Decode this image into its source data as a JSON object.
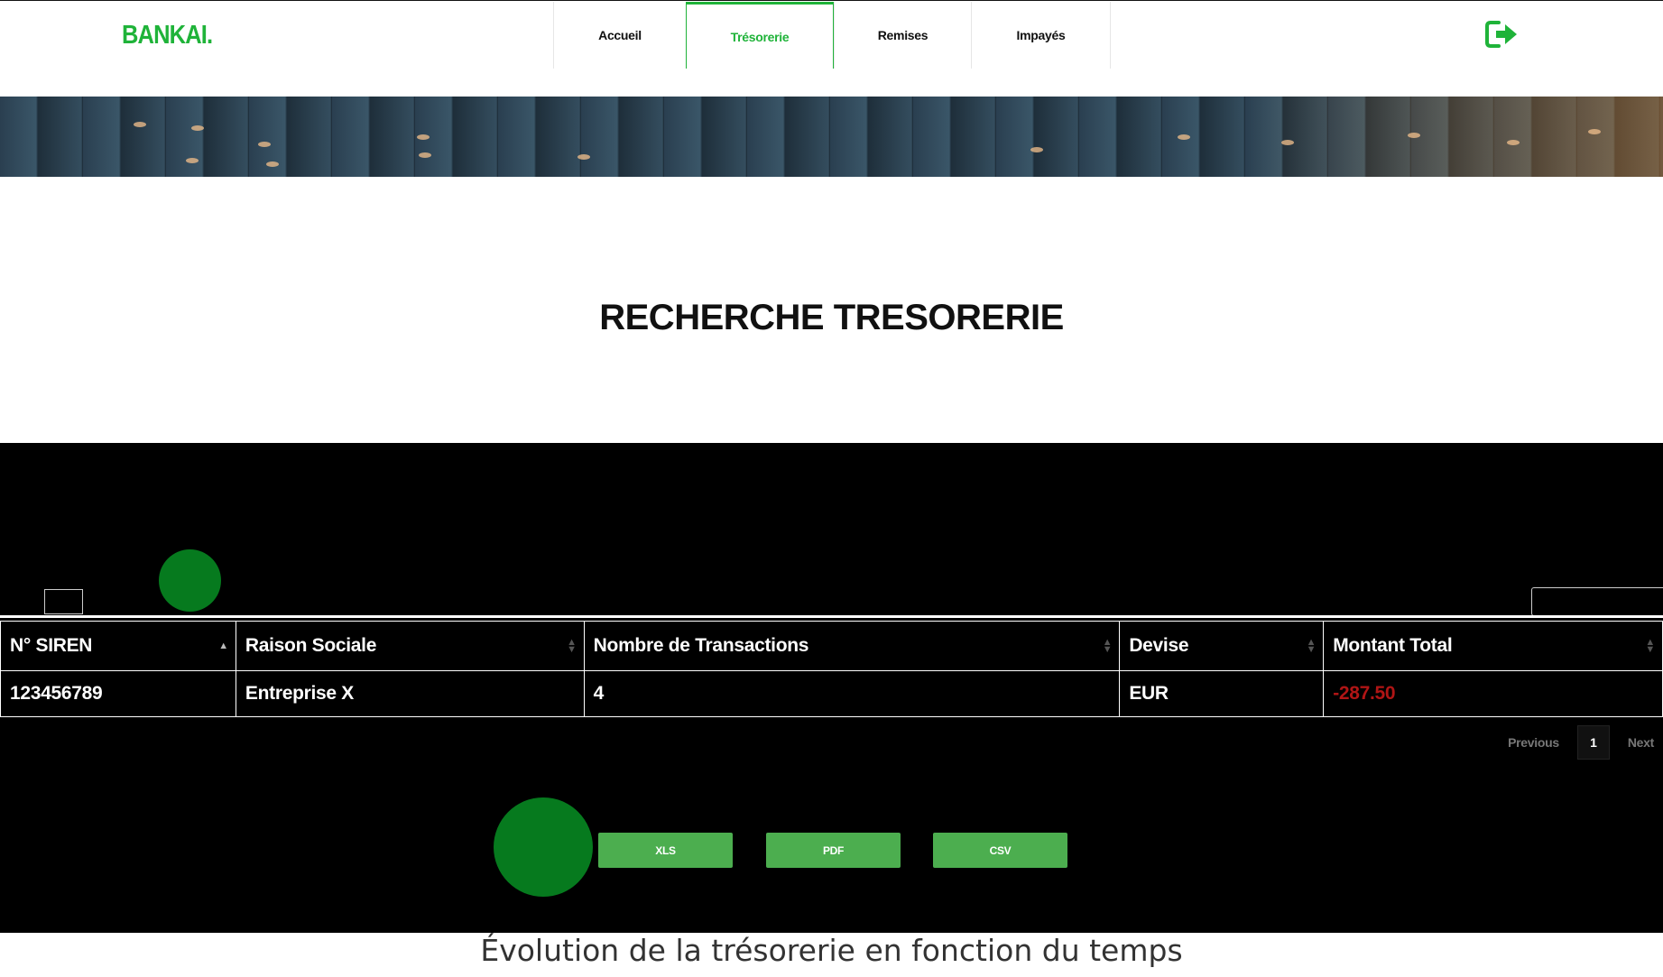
{
  "brand": "BANKAI.",
  "nav": {
    "items": [
      {
        "label": "Accueil",
        "active": false
      },
      {
        "label": "Trésorerie",
        "active": true
      },
      {
        "label": "Remises",
        "active": false
      },
      {
        "label": "Impayés",
        "active": false
      }
    ],
    "logout_icon": "logout-arrow-icon"
  },
  "page_title": "RECHERCHE TRESORERIE",
  "table": {
    "columns": [
      "N° SIREN",
      "Raison Sociale",
      "Nombre de Transactions",
      "Devise",
      "Montant Total"
    ],
    "rows": [
      [
        "123456789",
        "Entreprise X",
        "4",
        "EUR",
        "-287.50"
      ]
    ]
  },
  "pagination": {
    "previous": "Previous",
    "current_page": "1",
    "next": "Next"
  },
  "export": {
    "xls": "XLS",
    "pdf": "PDF",
    "csv": "CSV"
  },
  "chart_title": "Évolution de la trésorerie en fonction du temps",
  "colors": {
    "accent": "#1fb339",
    "button": "#4cae4f",
    "negative": "#b01515",
    "panel": "#000000"
  }
}
